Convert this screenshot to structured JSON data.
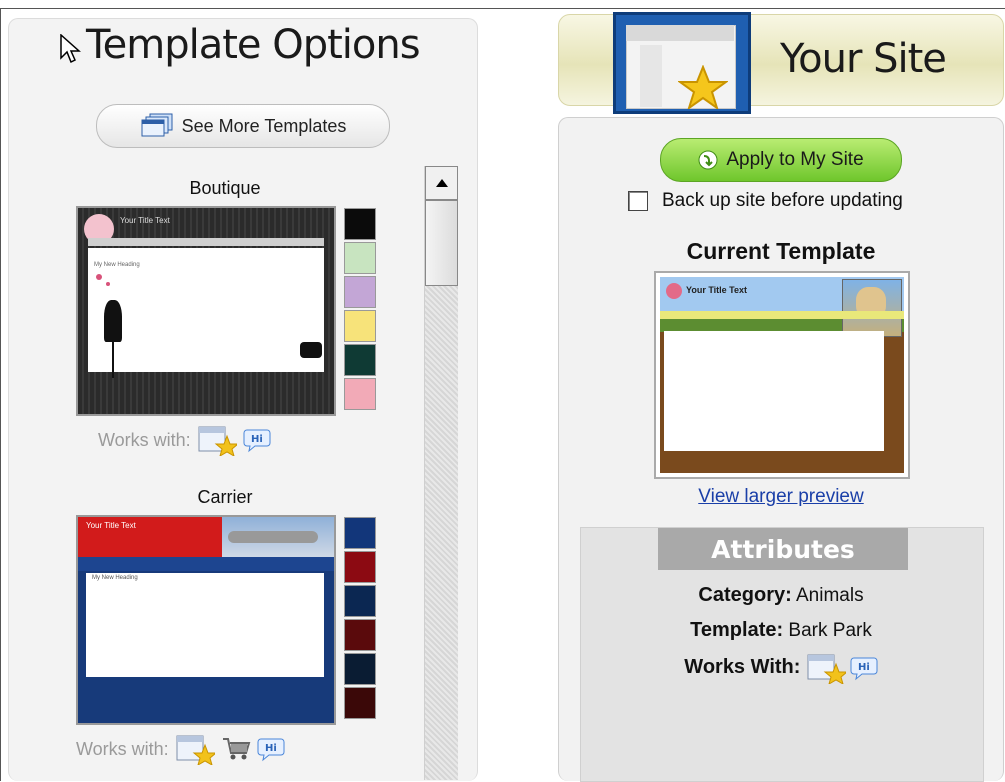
{
  "left": {
    "title": "Template Options",
    "see_more_label": "See More Templates",
    "works_with_label": "Works with:",
    "templates": [
      {
        "name": "Boutique",
        "thumb_title": "Your Title Text",
        "thumb_heading": "My New Heading",
        "swatches": [
          "#0b0b0b",
          "#c8e4c0",
          "#c3a6d6",
          "#f7e37a",
          "#0f3a34",
          "#f2aab7"
        ],
        "works_with": [
          "site-builder-icon",
          "hi-chat-icon"
        ]
      },
      {
        "name": "Carrier",
        "thumb_title": "Your Title Text",
        "thumb_heading": "My New Heading",
        "swatches": [
          "#12367a",
          "#8c0a12",
          "#0b2752",
          "#5a0a0c",
          "#0a1c33",
          "#3b0808"
        ],
        "works_with": [
          "site-builder-icon",
          "cart-icon",
          "hi-chat-icon"
        ]
      }
    ]
  },
  "right": {
    "header_title": "Your Site",
    "apply_label": "Apply to My Site",
    "backup_label": "Back up site before updating",
    "current_heading": "Current Template",
    "current_thumb_title": "Your Title Text",
    "view_larger_label": "View larger preview",
    "attributes_heading": "Attributes",
    "category_label": "Category:",
    "category_value": "Animals",
    "template_label": "Template:",
    "template_value": "Bark Park",
    "works_with_label": "Works With:"
  }
}
